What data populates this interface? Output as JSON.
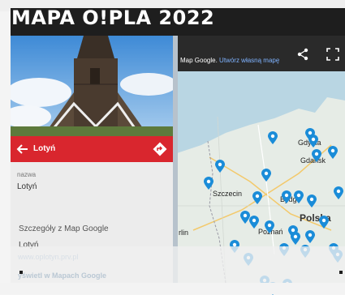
{
  "page": {
    "title": "MAPA O!PLA 2022"
  },
  "map": {
    "header_text": "Map Google.",
    "header_link": "Utwórz własną mapę",
    "labels": [
      {
        "id": "gdynia",
        "text": "Gdynia"
      },
      {
        "id": "gdansk",
        "text": "Gdańsk"
      },
      {
        "id": "szczecin",
        "text": "Szczecin"
      },
      {
        "id": "bydgoszcz",
        "text": "Bydg"
      },
      {
        "id": "polska",
        "text": "Polska"
      },
      {
        "id": "poznan",
        "text": "Poznań"
      },
      {
        "id": "berlin",
        "text": "rlin"
      },
      {
        "id": "dresden",
        "text": "rezno"
      }
    ],
    "pin_color": "#1a8cd8"
  },
  "panel": {
    "place_name": "Lotyń",
    "field_label": "nazwa",
    "field_value": "Lotyń",
    "details_heading": "Szczegóły z Map Google",
    "details_value": "Lotyń",
    "header_color": "#d9262e"
  },
  "footer": {
    "link_text": "www.oplotyn.prv.pl",
    "view_in_maps": "yświetl w Mapach Google"
  }
}
